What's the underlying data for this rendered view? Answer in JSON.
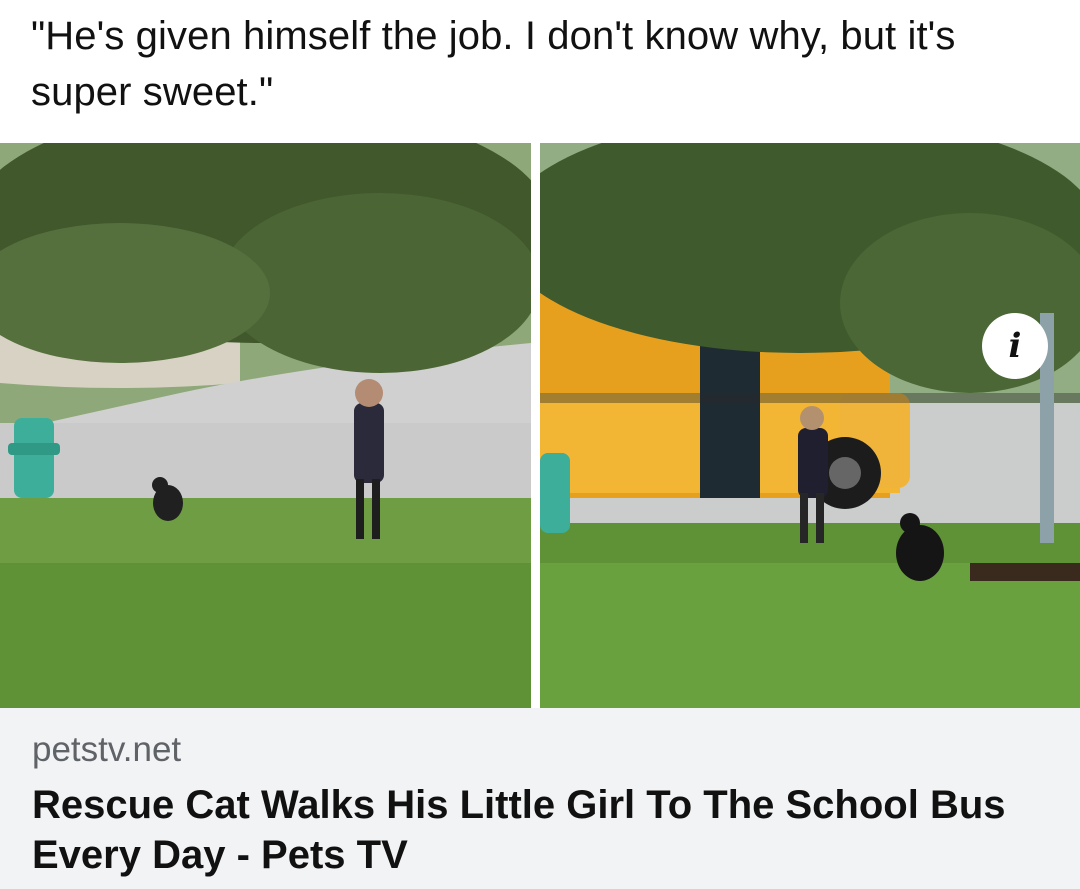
{
  "post": {
    "quote": "\"He's given himself the job. I don't know why, but it's super sweet.\""
  },
  "link_card": {
    "domain": "petstv.net",
    "headline": "Rescue Cat Walks His Little Girl To The School Bus Every Day - Pets TV",
    "info_icon": "info-icon"
  },
  "colors": {
    "card_background": "#f2f3f5",
    "domain_text": "#5f6266",
    "headline_text": "#111111"
  }
}
